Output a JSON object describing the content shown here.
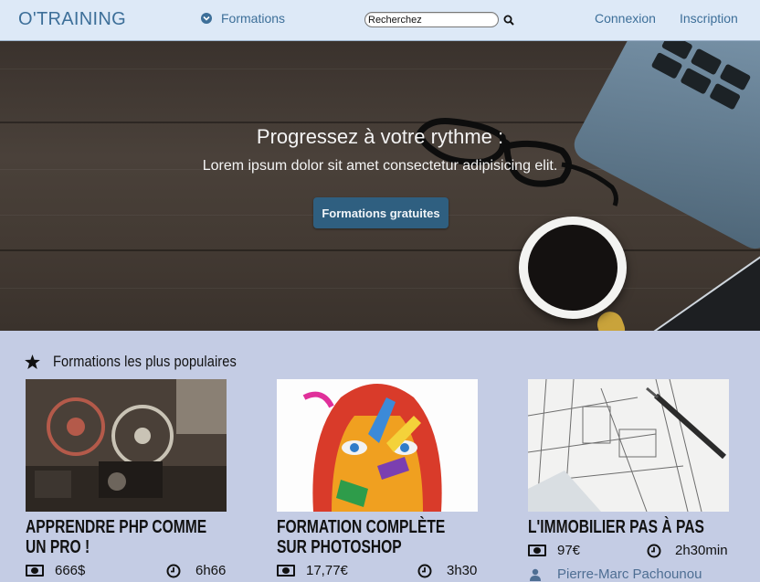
{
  "navbar": {
    "brand": "O'TRAINING",
    "formations_label": "Formations",
    "search_value": "Recherchez",
    "login_label": "Connexion",
    "signup_label": "Inscription"
  },
  "hero": {
    "title": "Progressez à votre rythme :",
    "subtitle": "Lorem ipsum dolor sit amet consectetur adipisicing elit.",
    "button_label": "Formations gratuites"
  },
  "popular": {
    "heading": "Formations les plus populaires",
    "courses": [
      {
        "title": "Apprendre PHP comme un pro !",
        "price": "666$",
        "duration": "6h66",
        "image": "film-projectors-photo"
      },
      {
        "title": "Formation complète sur Photoshop",
        "price": "17,77€",
        "duration": "3h30",
        "image": "painted-face-photo"
      },
      {
        "title": "L'immobilier pas à pas",
        "price": "97€",
        "duration": "2h30min",
        "author": "Pierre-Marc Pachounou",
        "image": "blueprint-pen-photo"
      }
    ]
  },
  "colors": {
    "navbar_bg": "#dde9f7",
    "brand_blue": "#3d6f99",
    "hero_button": "#2f5f80",
    "section_bg": "#c4cce4",
    "author_link": "#4e6e93"
  }
}
